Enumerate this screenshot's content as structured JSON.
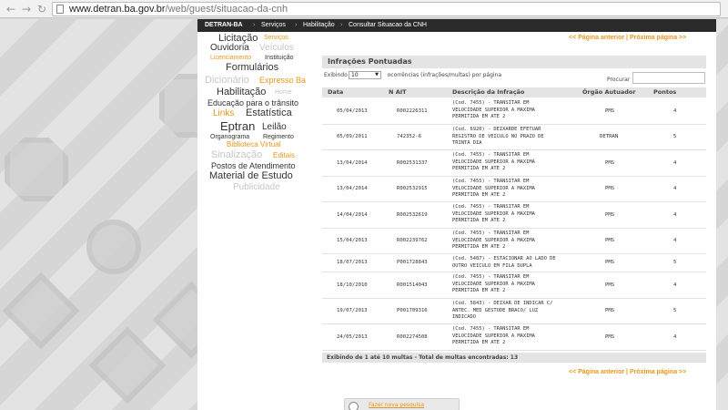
{
  "browser": {
    "url_domain": "www.detran.ba.gov.br",
    "url_path": "/web/guest/situacao-da-cnh",
    "back_icon": "arrow-left-icon",
    "forward_icon": "arrow-right-icon",
    "reload_icon": "reload-icon"
  },
  "topnav": {
    "brand": "DETRAN-BA",
    "items": [
      "Serviços",
      "Habilitação",
      "Consultar Situacao da CNH"
    ],
    "separator": "›"
  },
  "tags": [
    "Licitação",
    "Serviços",
    "Ouvidoria",
    "Veículos",
    "Licenciamento",
    "Instituição",
    "Formulários",
    "Dicionário",
    "Expresso Ba",
    "Habilitação",
    "Home",
    "Educação para o trânsito",
    "Links",
    "Estatística",
    "Eptran",
    "Leilão",
    "Organograma",
    "Regimento",
    "Biblioteca Virtual",
    "Sinalização",
    "Editais",
    "Postos de Atendimento",
    "Material de Estudo",
    "Publicidade"
  ],
  "pager": {
    "prev": "<< Página anterior",
    "sep": "|",
    "next": "Próxima página >>"
  },
  "section": {
    "title": "Infrações Pontuadas"
  },
  "length_control": {
    "prefix": "Exibindo",
    "value": "10",
    "suffix": "ocorrências (infrações/multas) por página"
  },
  "search": {
    "label": "Procurar"
  },
  "table": {
    "headers": [
      "Data",
      "N AIT",
      "Descrição da Infração",
      "Órgão Autuador",
      "Pontos"
    ],
    "rows": [
      {
        "date": "05/04/2013",
        "ait": "R002226311",
        "desc": "(Cod. 7455) - TRANSITAR EM\nVELOCIDADE SUPERIOR A MAXIMA\nPERMITIDA EM ATE 2",
        "org": "PMS",
        "pts": "4"
      },
      {
        "date": "05/09/2011",
        "ait": "742352-6",
        "desc": "(Cod. 6920) - DEIXARDE EFETUAR\nREGISTRO DE VEICULO NO PRAZO DE\nTRINTA DIA",
        "org": "DETRAN",
        "pts": "5"
      },
      {
        "date": "13/04/2014",
        "ait": "R002531337",
        "desc": "(Cod. 7455) - TRANSITAR EM\nVELOCIDADE SUPERIOR A MAXIMA\nPERMITIDA EM ATE 2",
        "org": "PMS",
        "pts": "4"
      },
      {
        "date": "13/04/2014",
        "ait": "R002532915",
        "desc": "(Cod. 7455) - TRANSITAR EM\nVELOCIDADE SUPERIOR A MAXIMA\nPERMITIDA EM ATE 2",
        "org": "PMS",
        "pts": "4"
      },
      {
        "date": "14/04/2014",
        "ait": "R002532619",
        "desc": "(Cod. 7455) - TRANSITAR EM\nVELOCIDADE SUPERIOR A MAXIMA\nPERMITIDA EM ATE 2",
        "org": "PMS",
        "pts": "4"
      },
      {
        "date": "15/04/2013",
        "ait": "R002239762",
        "desc": "(Cod. 7455) - TRANSITAR EM\nVELOCIDADE SUPERIOR A MAXIMA\nPERMITIDA EM ATE 2",
        "org": "PMS",
        "pts": "4"
      },
      {
        "date": "18/07/2013",
        "ait": "P001728843",
        "desc": "(Cod. 5487) - ESTACIONAR AO LADO DE\nOUTRO VEICULO EM FILA DUPLA",
        "org": "PMS",
        "pts": "5"
      },
      {
        "date": "18/10/2010",
        "ait": "R001514043",
        "desc": "(Cod. 7455) - TRANSITAR EM\nVELOCIDADE SUPERIOR A MAXIMA\nPERMITIDA EM ATE 2",
        "org": "PMS",
        "pts": "4"
      },
      {
        "date": "19/07/2013",
        "ait": "P001709316",
        "desc": "(Cod. 5843) - DEIXAR DE INDICAR C/\nANTEC. MED GESTODE BRACO/ LUZ\nINDICADO",
        "org": "PMS",
        "pts": "5"
      },
      {
        "date": "24/05/2013",
        "ait": "R002274508",
        "desc": "(Cod. 7455) - TRANSITAR EM\nVELOCIDADE SUPERIOR A MAXIMA\nPERMITIDA EM ATE 2",
        "org": "PMS",
        "pts": "4"
      }
    ],
    "footer": "Exibindo de 1 até 10 multas - Total de multas encontradas: 13"
  },
  "print_button": {
    "label": "Fazer nova pesquisa",
    "icon": "magnifier-icon"
  },
  "colors": {
    "accent": "#e8961e",
    "nav_bg": "#2a2a2a",
    "header_bg": "#e4e4e4"
  }
}
